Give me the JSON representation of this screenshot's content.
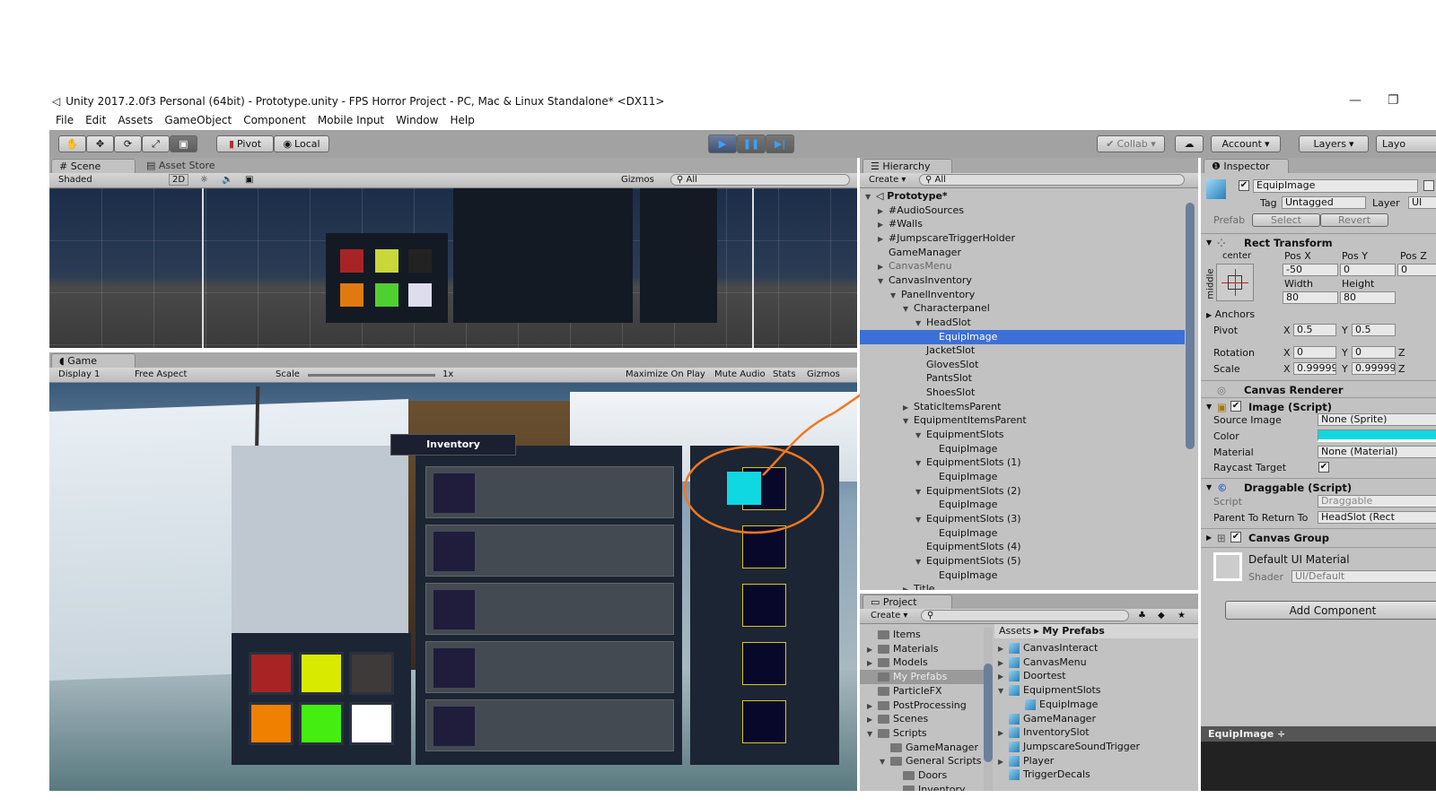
{
  "window": {
    "title": "Unity 2017.2.0f3 Personal (64bit) - Prototype.unity - FPS Horror Project - PC, Mac & Linux Standalone* <DX11>",
    "minimize": "—",
    "restore": "❐"
  },
  "menu": [
    "File",
    "Edit",
    "Assets",
    "GameObject",
    "Component",
    "Mobile Input",
    "Window",
    "Help"
  ],
  "toolbar": {
    "tools": [
      "✋",
      "✥",
      "⟳",
      "⤢",
      "▣"
    ],
    "pivot": "Pivot",
    "local": "Local",
    "play": "▶",
    "pause": "❚❚",
    "step": "▶|",
    "collab": "Collab ▾",
    "cloud": "☁",
    "account": "Account",
    "layers": "Layers",
    "layout": "Layo",
    "play_active": true
  },
  "scene": {
    "tab": "Scene",
    "tab2": "Asset Store",
    "shading": "Shaded",
    "mode2d": "2D",
    "gizmos": "Gizmos",
    "search_placeholder": "All"
  },
  "game": {
    "tab": "Game",
    "display": "Display 1",
    "aspect": "Free Aspect",
    "scale_label": "Scale",
    "scale_value": "1x",
    "maximize": "Maximize On Play",
    "mute": "Mute Audio",
    "stats": "Stats",
    "gizmos": "Gizmos",
    "inventory_title": "Inventory",
    "item_colors": [
      "#a82424",
      "#d8ea00",
      "#3e3a3a",
      "#f08000",
      "#44ee10",
      "#ffffff"
    ],
    "equip_color": "#10d8e0",
    "annotation_color": "#f07820"
  },
  "hierarchy": {
    "tab": "Hierarchy",
    "create": "Create",
    "search_placeholder": "All",
    "items": [
      {
        "label": "Prototype*",
        "level": 0,
        "arrow": "open",
        "bold": true
      },
      {
        "label": "#AudioSources",
        "level": 1,
        "arrow": "closed"
      },
      {
        "label": "#Walls",
        "level": 1,
        "arrow": "closed"
      },
      {
        "label": "#JumpscareTriggerHolder",
        "level": 1,
        "arrow": "closed"
      },
      {
        "label": "GameManager",
        "level": 1
      },
      {
        "label": "CanvasMenu",
        "level": 1,
        "arrow": "closed",
        "dim": true
      },
      {
        "label": "CanvasInventory",
        "level": 1,
        "arrow": "open"
      },
      {
        "label": "PanelInventory",
        "level": 2,
        "arrow": "open"
      },
      {
        "label": "Characterpanel",
        "level": 3,
        "arrow": "open"
      },
      {
        "label": "HeadSlot",
        "level": 4,
        "arrow": "open"
      },
      {
        "label": "EquipImage",
        "level": 5,
        "selected": true
      },
      {
        "label": "JacketSlot",
        "level": 4
      },
      {
        "label": "GlovesSlot",
        "level": 4
      },
      {
        "label": "PantsSlot",
        "level": 4
      },
      {
        "label": "ShoesSlot",
        "level": 4
      },
      {
        "label": "StaticItemsParent",
        "level": 3,
        "arrow": "closed"
      },
      {
        "label": "EquipmentItemsParent",
        "level": 3,
        "arrow": "open"
      },
      {
        "label": "EquipmentSlots",
        "level": 4,
        "arrow": "open"
      },
      {
        "label": "EquipImage",
        "level": 5
      },
      {
        "label": "EquipmentSlots (1)",
        "level": 4,
        "arrow": "open"
      },
      {
        "label": "EquipImage",
        "level": 5
      },
      {
        "label": "EquipmentSlots (2)",
        "level": 4,
        "arrow": "open"
      },
      {
        "label": "EquipImage",
        "level": 5
      },
      {
        "label": "EquipmentSlots (3)",
        "level": 4,
        "arrow": "open"
      },
      {
        "label": "EquipImage",
        "level": 5
      },
      {
        "label": "EquipmentSlots (4)",
        "level": 4
      },
      {
        "label": "EquipmentSlots (5)",
        "level": 4,
        "arrow": "open"
      },
      {
        "label": "EquipImage",
        "level": 5
      },
      {
        "label": "Title",
        "level": 3,
        "arrow": "closed"
      }
    ]
  },
  "project": {
    "tab": "Project",
    "create": "Create",
    "breadcrumb_root": "Assets",
    "breadcrumb_current": "My Prefabs",
    "folders": [
      {
        "label": "Items",
        "level": 1
      },
      {
        "label": "Materials",
        "level": 1,
        "arrow": "closed"
      },
      {
        "label": "Models",
        "level": 1,
        "arrow": "closed"
      },
      {
        "label": "My Prefabs",
        "level": 1,
        "selected": true
      },
      {
        "label": "ParticleFX",
        "level": 1
      },
      {
        "label": "PostProcessing",
        "level": 1,
        "arrow": "closed"
      },
      {
        "label": "Scenes",
        "level": 1,
        "arrow": "closed"
      },
      {
        "label": "Scripts",
        "level": 1,
        "arrow": "open"
      },
      {
        "label": "GameManager",
        "level": 2
      },
      {
        "label": "General Scripts",
        "level": 2,
        "arrow": "open"
      },
      {
        "label": "Doors",
        "level": 3
      },
      {
        "label": "Inventory",
        "level": 3
      }
    ],
    "assets": [
      {
        "label": "CanvasInteract",
        "arrow": "closed"
      },
      {
        "label": "CanvasMenu",
        "arrow": "closed"
      },
      {
        "label": "Doortest",
        "arrow": "closed"
      },
      {
        "label": "EquipmentSlots",
        "arrow": "open"
      },
      {
        "label": "EquipImage",
        "child": true
      },
      {
        "label": "GameManager"
      },
      {
        "label": "InventorySlot",
        "arrow": "closed"
      },
      {
        "label": "JumpscareSoundTrigger"
      },
      {
        "label": "Player",
        "arrow": "closed"
      },
      {
        "label": "TriggerDecals"
      }
    ]
  },
  "inspector": {
    "tab": "Inspector",
    "name": "EquipImage",
    "active": true,
    "tag_label": "Tag",
    "tag": "Untagged",
    "layer_label": "Layer",
    "layer": "UI",
    "prefab_label": "Prefab",
    "select": "Select",
    "revert": "Revert",
    "rect_transform": {
      "title": "Rect Transform",
      "anchor_h": "center",
      "anchor_v": "middle",
      "pos_x_label": "Pos X",
      "pos_y_label": "Pos Y",
      "pos_z_label": "Pos Z",
      "pos_x": "-50",
      "pos_y": "0",
      "pos_z": "0",
      "width_label": "Width",
      "height_label": "Height",
      "width": "80",
      "height": "80",
      "anchors": "Anchors",
      "pivot_label": "Pivot",
      "pivot_x": "0.5",
      "pivot_y": "0.5",
      "rotation_label": "Rotation",
      "rot_x": "0",
      "rot_y": "0",
      "scale_label": "Scale",
      "scale_x": "0.99999",
      "scale_y": "0.99999",
      "x": "X",
      "y": "Y",
      "z": "Z"
    },
    "canvas_renderer": "Canvas Renderer",
    "image": {
      "title": "Image (Script)",
      "source_label": "Source Image",
      "source": "None (Sprite)",
      "color_label": "Color",
      "color": "#10d8e0",
      "material_label": "Material",
      "material": "None (Material)",
      "raycast_label": "Raycast Target",
      "raycast": true
    },
    "draggable": {
      "title": "Draggable (Script)",
      "script_label": "Script",
      "script": "Draggable",
      "parent_label": "Parent To Return To",
      "parent": "HeadSlot (Rect"
    },
    "canvas_group": "Canvas Group",
    "material": {
      "name": "Default UI Material",
      "shader_label": "Shader",
      "shader": "UI/Default"
    },
    "add_component": "Add Component",
    "footer": "EquipImage ÷"
  }
}
